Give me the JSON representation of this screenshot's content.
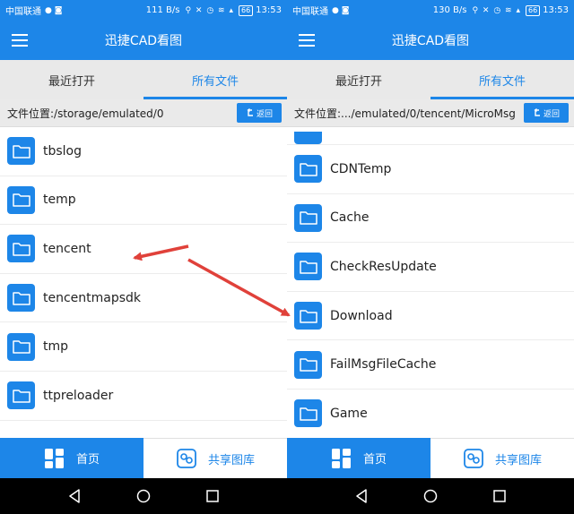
{
  "screens": [
    {
      "status": {
        "carrier": "中国联通",
        "speed": "111 B/s",
        "battery": "66",
        "time": "13:53"
      },
      "app_title": "迅捷CAD看图",
      "tabs": [
        "最近打开",
        "所有文件"
      ],
      "path_text": "文件位置:/storage/emulated/0",
      "back_label": "返回",
      "files": [
        "tbslog",
        "temp",
        "tencent",
        "tencentmapsdk",
        "tmp",
        "ttpreloader"
      ],
      "nav": {
        "home": "首页",
        "shared": "共享图库"
      }
    },
    {
      "status": {
        "carrier": "中国联通",
        "speed": "130 B/s",
        "battery": "66",
        "time": "13:53"
      },
      "app_title": "迅捷CAD看图",
      "tabs": [
        "最近打开",
        "所有文件"
      ],
      "path_text": "文件位置:.../emulated/0/tencent/MicroMsg",
      "back_label": "返回",
      "files": [
        "CDNTemp",
        "Cache",
        "CheckResUpdate",
        "Download",
        "FailMsgFileCache",
        "Game"
      ],
      "nav": {
        "home": "首页",
        "shared": "共享图库"
      }
    }
  ],
  "active_tab_index": 1,
  "colors": {
    "accent": "#1d86e8",
    "annotation_arrow": "#e0413a",
    "system_nav": "#000000"
  },
  "icons": [
    "menu-icon",
    "back-arrow-icon",
    "folder-icon",
    "home-grid-icon",
    "shared-gallery-icon",
    "nav-back-icon",
    "nav-home-icon",
    "nav-recents-icon"
  ]
}
